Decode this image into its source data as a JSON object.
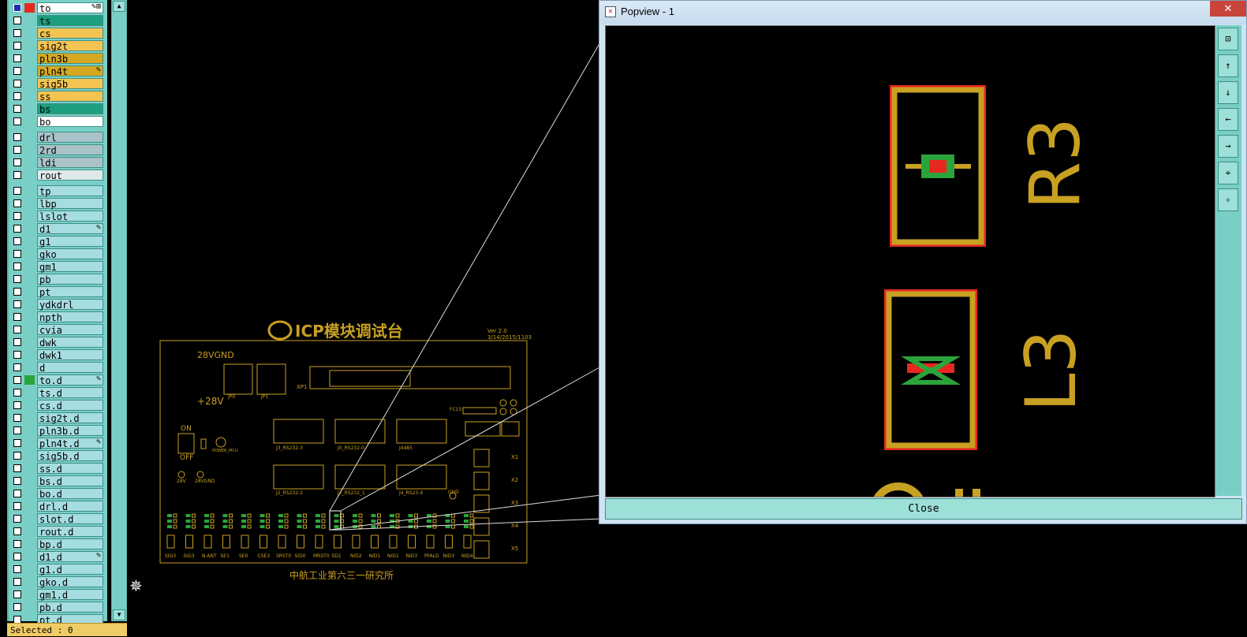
{
  "layers": {
    "group1": [
      {
        "name": "to",
        "color": "#ffffff",
        "swatch": "#e8281f",
        "active": true,
        "tag": "✎⊞"
      },
      {
        "name": "ts",
        "color": "#1e9e7e",
        "swatch": "",
        "tag": ""
      },
      {
        "name": "cs",
        "color": "#f3c452",
        "swatch": "",
        "tag": ""
      },
      {
        "name": "sig2t",
        "color": "#f3c452",
        "swatch": "",
        "tag": ""
      },
      {
        "name": "pln3b",
        "color": "#d6a822",
        "swatch": "",
        "tag": ""
      },
      {
        "name": "pln4t",
        "color": "#d6a822",
        "swatch": "",
        "tag": "✎"
      },
      {
        "name": "sig5b",
        "color": "#f3c452",
        "swatch": "",
        "tag": ""
      },
      {
        "name": "ss",
        "color": "#f3c452",
        "swatch": "",
        "tag": ""
      },
      {
        "name": "bs",
        "color": "#1e9e7e",
        "swatch": "",
        "tag": ""
      },
      {
        "name": "bo",
        "color": "#ffffff",
        "swatch": "",
        "tag": ""
      }
    ],
    "group2": [
      {
        "name": "drl",
        "color": "#a9c3c8",
        "swatch": "",
        "tag": ""
      },
      {
        "name": "2rd",
        "color": "#a9c3c8",
        "swatch": "",
        "tag": ""
      },
      {
        "name": "ldi",
        "color": "#a9c3c8",
        "swatch": "",
        "tag": ""
      },
      {
        "name": "rout",
        "color": "#dfe9ea",
        "swatch": "",
        "tag": ""
      }
    ],
    "group3": [
      {
        "name": "tp",
        "tag": ""
      },
      {
        "name": "lbp",
        "tag": ""
      },
      {
        "name": "lslot",
        "tag": ""
      },
      {
        "name": "d1",
        "tag": "✎"
      },
      {
        "name": "g1",
        "tag": ""
      },
      {
        "name": "gko",
        "tag": ""
      },
      {
        "name": "gm1",
        "tag": ""
      },
      {
        "name": "pb",
        "tag": ""
      },
      {
        "name": "pt",
        "tag": ""
      },
      {
        "name": "ydkdrl",
        "tag": ""
      },
      {
        "name": "npth",
        "tag": ""
      },
      {
        "name": "cvia",
        "tag": ""
      },
      {
        "name": "dwk",
        "tag": ""
      },
      {
        "name": "dwk1",
        "tag": ""
      },
      {
        "name": "d",
        "tag": ""
      },
      {
        "name": "to.d",
        "tag": "✎",
        "swatch": "#2aa43a"
      },
      {
        "name": "ts.d",
        "tag": ""
      },
      {
        "name": "cs.d",
        "tag": ""
      },
      {
        "name": "sig2t.d",
        "tag": ""
      },
      {
        "name": "pln3b.d",
        "tag": ""
      },
      {
        "name": "pln4t.d",
        "tag": "✎"
      },
      {
        "name": "sig5b.d",
        "tag": ""
      },
      {
        "name": "ss.d",
        "tag": ""
      },
      {
        "name": "bs.d",
        "tag": ""
      },
      {
        "name": "bo.d",
        "tag": ""
      },
      {
        "name": "drl.d",
        "tag": ""
      },
      {
        "name": "slot.d",
        "tag": ""
      },
      {
        "name": "rout.d",
        "tag": ""
      },
      {
        "name": "bp.d",
        "tag": ""
      },
      {
        "name": "d1.d",
        "tag": "✎"
      },
      {
        "name": "g1.d",
        "tag": ""
      },
      {
        "name": "gko.d",
        "tag": ""
      },
      {
        "name": "gm1.d",
        "tag": ""
      },
      {
        "name": "pb.d",
        "tag": ""
      },
      {
        "name": "pt.d",
        "tag": ""
      }
    ],
    "group3_color": "#a6dde0"
  },
  "status": {
    "selected": "Selected : 0"
  },
  "board": {
    "title": "ICP模块调试台",
    "version": "Ver 2.0",
    "date": "3/14/2015/1103",
    "label_28vgnd": "28VGND",
    "label_plus28v": "+28V",
    "label_on": "ON",
    "label_off": "OFF",
    "label_xp1": "XP1",
    "label_jp0": "JP0",
    "label_jp1": "JP1",
    "label_fc15": "FC15",
    "label_gnd": "GND",
    "label_28v": "28V",
    "label_28vgnd_small": "28VGND",
    "label_power": "POWER_MCU",
    "connectors": [
      "J3_RS232-3",
      "J0_RS232-0",
      "J4485",
      "J2_RS232-2",
      "J2_RS232_1",
      "J4_RS23-4"
    ],
    "x_labels": [
      "X1",
      "X2",
      "X3",
      "X4",
      "X5"
    ],
    "bottom_labels": [
      "SIG3",
      "SIG3",
      "N.ANT",
      "SE1",
      "SE0",
      "CSE3",
      "SRST0",
      "SID0",
      "MRST0",
      "SD1",
      "NID2",
      "NID1",
      "NID1",
      "NID3",
      "PFALD",
      "NID3",
      "NID4"
    ],
    "footer": "中航工业第六三一研究所"
  },
  "popview": {
    "title": "Popview - 1",
    "close_x": "✕",
    "close_label": "Close",
    "ref_r3": "R3",
    "ref_l3": "L3",
    "tools": [
      "zoom-fit-icon",
      "pan-up-icon",
      "pan-down-icon",
      "pan-left-icon",
      "pan-right-icon",
      "zoom-in-icon",
      "zoom-out-icon"
    ],
    "tool_glyphs": [
      "⊡",
      "↑",
      "↓",
      "←",
      "→",
      "⌖",
      "✧"
    ]
  },
  "cursor_icon": "✵"
}
